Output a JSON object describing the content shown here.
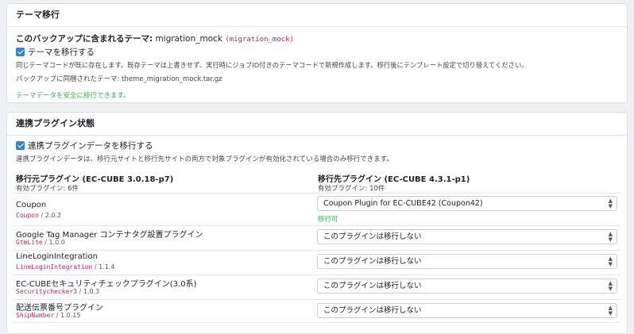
{
  "theme_section": {
    "header": "テーマ移行",
    "backup_label": "このバックアップに含まれるテーマ:",
    "backup_theme_name": "migration_mock",
    "backup_theme_code": "(migration_mock)",
    "migrate_checkbox_label": "テーマを移行する",
    "migrate_checked": true,
    "description": "同じテーマコードが既に存在します。既存テーマは上書きせず、実行時にジョブID付きのテーマコードで新規作成します。移行後にテンプレート設定で切り替えてください。",
    "bundled_file_text": "バックアップに同梱されたテーマ: theme_migration_mock.tar.gz",
    "safe_message": "テーマデータを安全に移行できます。"
  },
  "plugin_section": {
    "header": "連携プラグイン状態",
    "migrate_checkbox_label": "連携プラグインデータを移行する",
    "migrate_checked": true,
    "description": "連携プラグインデータは、移行元サイトと移行先サイトの両方で対象プラグインが有効化されている場合のみ移行できます。",
    "source_title": "移行元プラグイン (EC-CUBE 3.0.18-p7)",
    "source_count": "有効プラグイン: 6件",
    "target_title": "移行先プラグイン (EC-CUBE 4.3.1-p1)",
    "target_count": "有効プラグイン: 10件",
    "rows": [
      {
        "name": "Coupon",
        "code": "Coupon",
        "version": "/ 2.0.2",
        "selected": "Coupon Plugin for EC-CUBE42 (Coupon42)",
        "status": "移行可"
      },
      {
        "name": "Google Tag Manager コンテナタグ設置プラグイン",
        "code": "GtmLite",
        "version": "/ 1.0.0",
        "selected": "このプラグインは移行しない",
        "status": ""
      },
      {
        "name": "LineLoginIntegration",
        "code": "LineLoginIntegration",
        "version": "/ 1.1.4",
        "selected": "このプラグインは移行しない",
        "status": ""
      },
      {
        "name": "EC-CUBEセキュリティチェックプラグイン(3.0系)",
        "code": "Securitychecker3",
        "version": "/ 1.0.3",
        "selected": "このプラグインは移行しない",
        "status": ""
      },
      {
        "name": "配送伝票番号プラグイン",
        "code": "ShipNumber",
        "version": "/ 1.0.15",
        "selected": "このプラグインは移行しない",
        "status": ""
      }
    ]
  },
  "colors": {
    "accent_checkbox": "#3b82c4",
    "success_text": "#2bb24c",
    "code_text": "#c2185b"
  }
}
